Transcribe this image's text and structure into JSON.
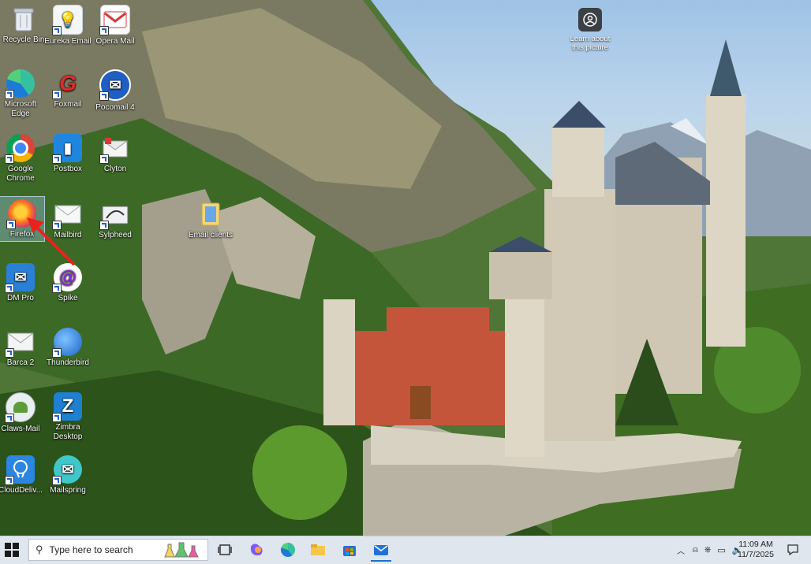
{
  "desktop": {
    "icons": [
      {
        "label": "Recycle Bin"
      },
      {
        "label": "Eureka Email"
      },
      {
        "label": "Opera Mail"
      },
      {
        "label": "Microsoft Edge"
      },
      {
        "label": "Foxmail"
      },
      {
        "label": "Pocomail 4"
      },
      {
        "label": "Google Chrome"
      },
      {
        "label": "Postbox"
      },
      {
        "label": "Clyton"
      },
      {
        "label": "Firefox"
      },
      {
        "label": "Mailbird"
      },
      {
        "label": "Sylpheed"
      },
      {
        "label": "Email clients"
      },
      {
        "label": "DM Pro"
      },
      {
        "label": "Spike"
      },
      {
        "label": "Barca 2"
      },
      {
        "label": "Thunderbird"
      },
      {
        "label": "Claws-Mail"
      },
      {
        "label": "Zimbra Desktop"
      },
      {
        "label": "CloudDeliv..."
      },
      {
        "label": "Mailspring"
      }
    ],
    "learn_label": "Learn about this picture"
  },
  "taskbar": {
    "search_placeholder": "Type here to search",
    "time": "11:09 AM",
    "date": "11/7/2025"
  },
  "colors": {
    "taskbar_bg": "#dfe6ee",
    "annotation_arrow": "#e8231c"
  }
}
